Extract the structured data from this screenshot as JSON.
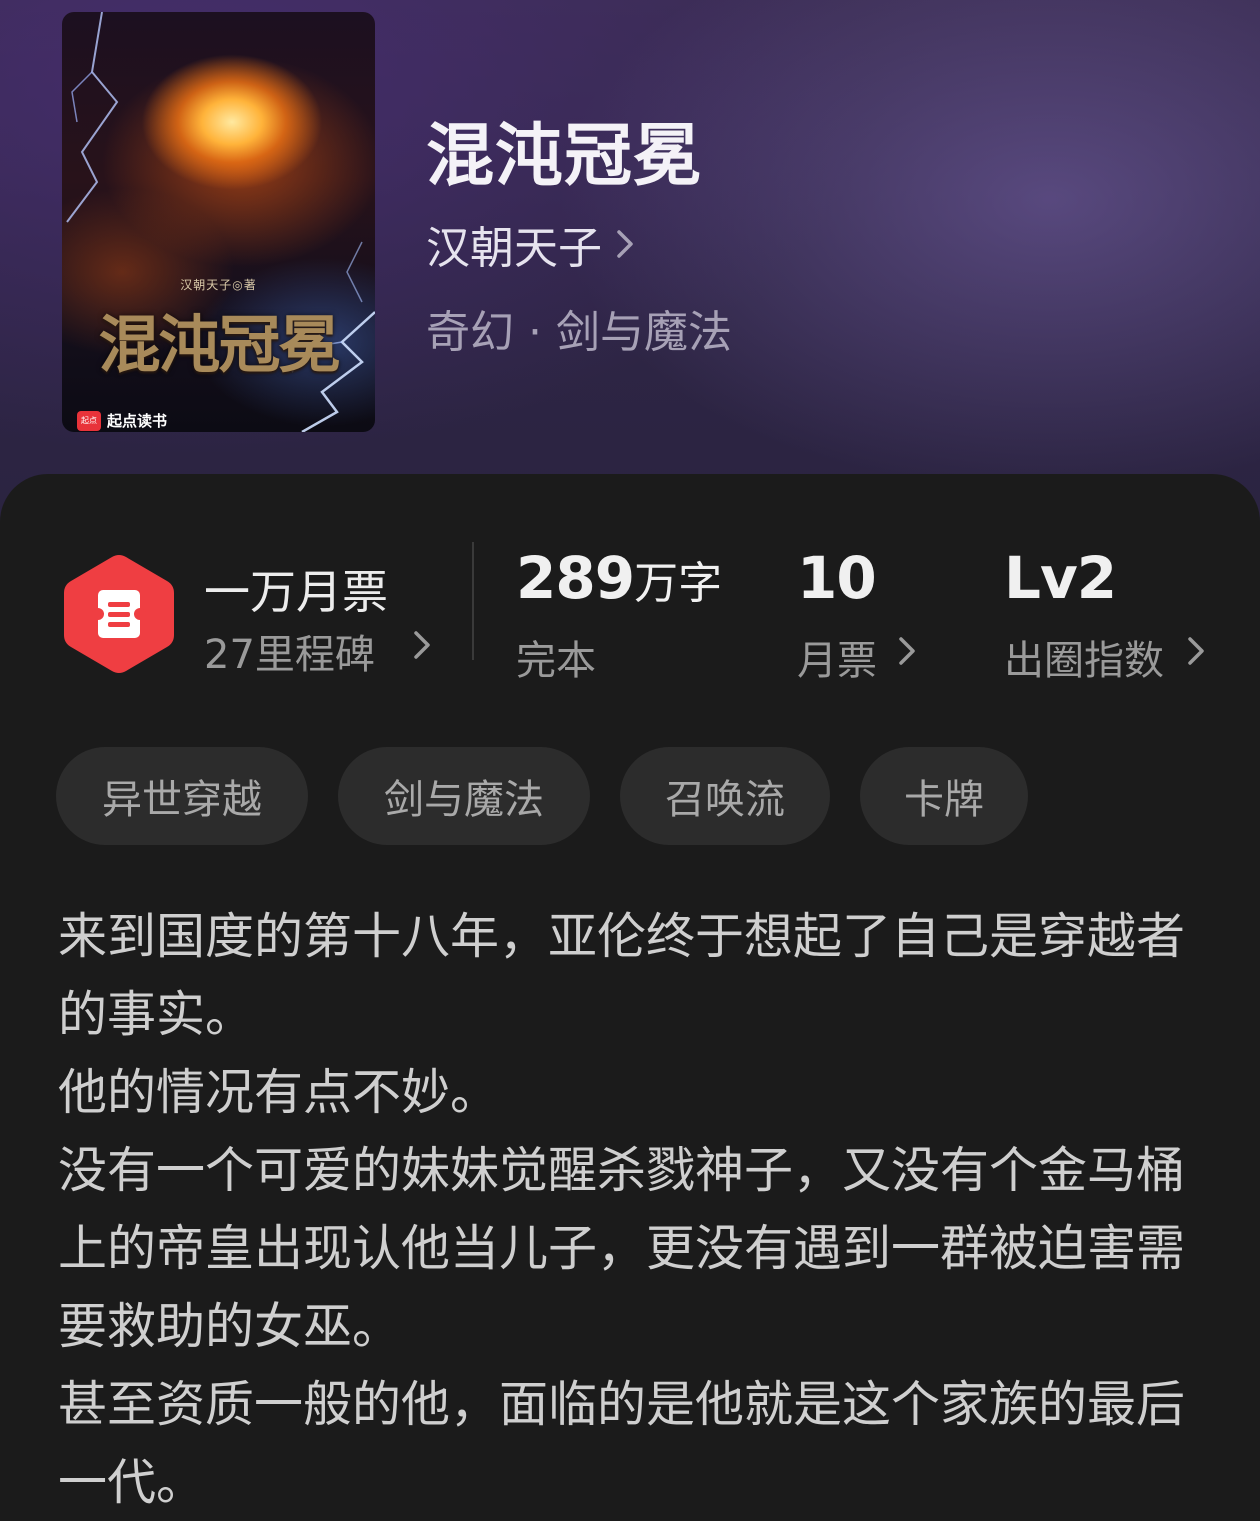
{
  "book": {
    "title": "混沌冠冕",
    "author": "汉朝天子",
    "genre": "奇幻 · 剑与魔法"
  },
  "cover": {
    "author_line": "汉朝天子◎著",
    "title": "混沌冠冕",
    "brand_icon": "起点",
    "brand": "起点读书"
  },
  "stats": {
    "milestone_title": "一万月票",
    "milestone_sub": "27里程碑",
    "word_count": "289",
    "word_unit": "万字",
    "status": "完本",
    "monthly_tickets": "10",
    "monthly_tickets_label": "月票",
    "level": "Lv2",
    "level_label": "出圈指数"
  },
  "tags": [
    "异世穿越",
    "剑与魔法",
    "召唤流",
    "卡牌"
  ],
  "synopsis": [
    "来到国度的第十八年，亚伦终于想起了自己是穿越者的事实。",
    "他的情况有点不妙。",
    "没有一个可爱的妹妹觉醒杀戮神子，又没有个金马桶上的帝皇出现认他当儿子，更没有遇到一群被迫害需要救助的女巫。",
    "甚至资质一般的他，面临的是他就是这个家族的最后一代。"
  ],
  "colors": {
    "badge_red": "#ef3e42",
    "card_bg": "#1b1b1b",
    "tag_bg": "#2c2c2c"
  },
  "icons": {
    "milestone": "ticket-icon",
    "chevron": "chevron-right-icon"
  }
}
